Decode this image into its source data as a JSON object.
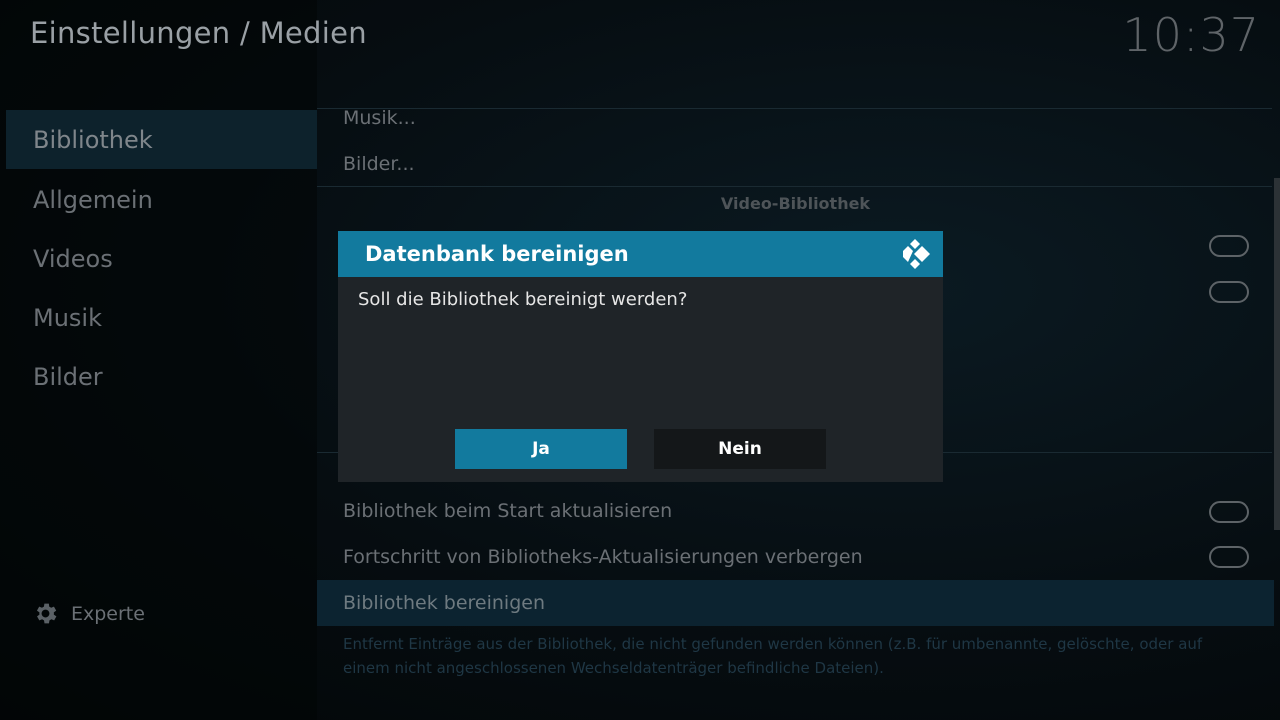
{
  "header": {
    "title": "Einstellungen / Medien",
    "clock": "10:37"
  },
  "sidebar": {
    "items": [
      {
        "label": "Bibliothek"
      },
      {
        "label": "Allgemein"
      },
      {
        "label": "Videos"
      },
      {
        "label": "Musik"
      },
      {
        "label": "Bilder"
      }
    ],
    "experte_label": "Experte"
  },
  "main": {
    "rows_top": [
      {
        "label": "Musik..."
      },
      {
        "label": "Bilder..."
      }
    ],
    "section_title": "Video-Bibliothek",
    "rows_bottom": [
      {
        "label": "Bibliothek beim Start aktualisieren"
      },
      {
        "label": "Fortschritt von Bibliotheks-Aktualisierungen verbergen"
      },
      {
        "label": "Bibliothek bereinigen"
      }
    ],
    "description": "Entfernt Einträge aus der Bibliothek, die nicht gefunden werden können (z.B. für umbenannte, gelöschte, oder auf einem nicht angeschlossenen Wechseldatenträger befindliche Dateien)."
  },
  "dialog": {
    "title": "Datenbank bereinigen",
    "message": "Soll die Bibliothek bereinigt werden?",
    "yes_label": "Ja",
    "no_label": "Nein"
  },
  "colors": {
    "accent": "#127a9e",
    "dialog_bg": "#1f2428"
  }
}
